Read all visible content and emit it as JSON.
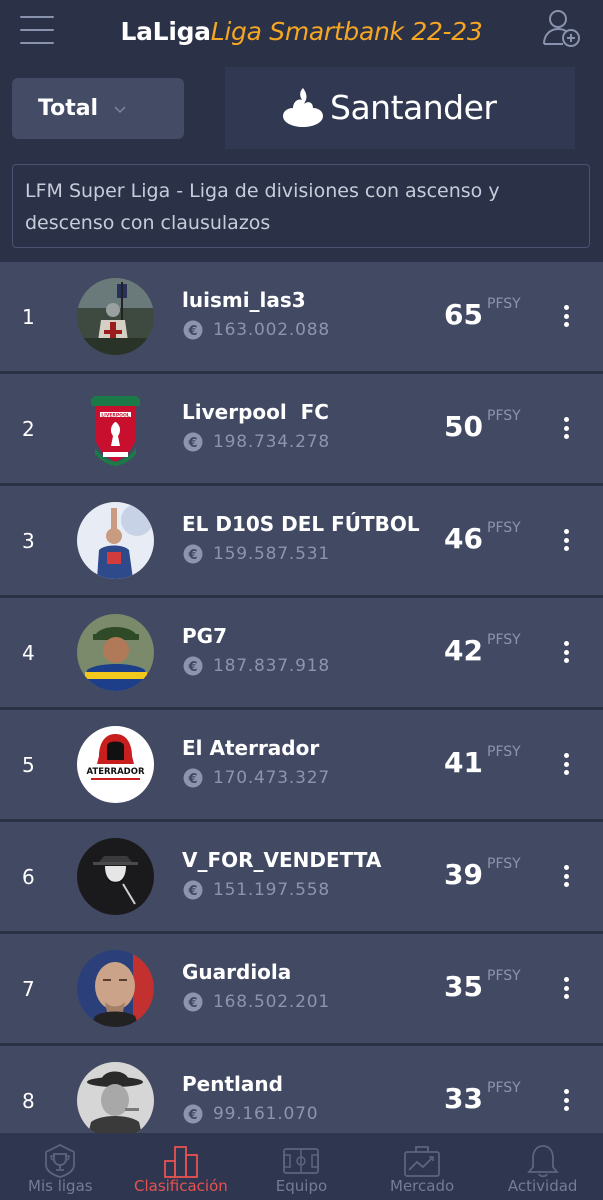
{
  "header": {
    "title_brand": "LaLiga",
    "title_sub": "Liga Smartbank 22-23"
  },
  "filter": {
    "selected": "Total"
  },
  "sponsor": {
    "name": "Santander"
  },
  "league": {
    "description": "LFM Super Liga - Liga de divisiones con ascenso y descenso con clausulazos"
  },
  "ranking": {
    "points_unit": "PFSY",
    "rows": [
      {
        "pos": "1",
        "name": "luismi_las3",
        "value": "163.002.088",
        "points": "65",
        "avatar": "knight-avatar"
      },
      {
        "pos": "2",
        "name": "Liverpool  FC",
        "value": "198.734.278",
        "points": "50",
        "avatar": "liverpool-crest-avatar"
      },
      {
        "pos": "3",
        "name": "EL D10S DEL FÚTBOL",
        "value": "159.587.531",
        "points": "46",
        "avatar": "player-avatar"
      },
      {
        "pos": "4",
        "name": "PG7",
        "value": "187.837.918",
        "points": "42",
        "avatar": "player-avatar"
      },
      {
        "pos": "5",
        "name": "El Aterrador",
        "value": "170.473.327",
        "points": "41",
        "avatar": "hooded-figure-avatar"
      },
      {
        "pos": "6",
        "name": "V_FOR_VENDETTA",
        "value": "151.197.558",
        "points": "39",
        "avatar": "vendetta-avatar"
      },
      {
        "pos": "7",
        "name": "Guardiola",
        "value": "168.502.201",
        "points": "35",
        "avatar": "coach-avatar"
      },
      {
        "pos": "8",
        "name": "Pentland",
        "value": "99.161.070",
        "points": "33",
        "avatar": "hat-man-avatar"
      }
    ]
  },
  "avatar_logo_text": {
    "liverpool": "LIVERPOOL",
    "aterrador": "ATERRADOR"
  },
  "nav": {
    "items": [
      {
        "label": "Mis ligas",
        "icon": "trophy-icon"
      },
      {
        "label": "Clasificación",
        "icon": "bar-chart-icon"
      },
      {
        "label": "Equipo",
        "icon": "pitch-icon"
      },
      {
        "label": "Mercado",
        "icon": "briefcase-icon"
      },
      {
        "label": "Actividad",
        "icon": "bell-icon"
      }
    ],
    "active_index": 1
  },
  "colors": {
    "background": "#2b3147",
    "row": "#424a63",
    "accent_orange": "#f5a623",
    "active_red": "#e85151"
  }
}
